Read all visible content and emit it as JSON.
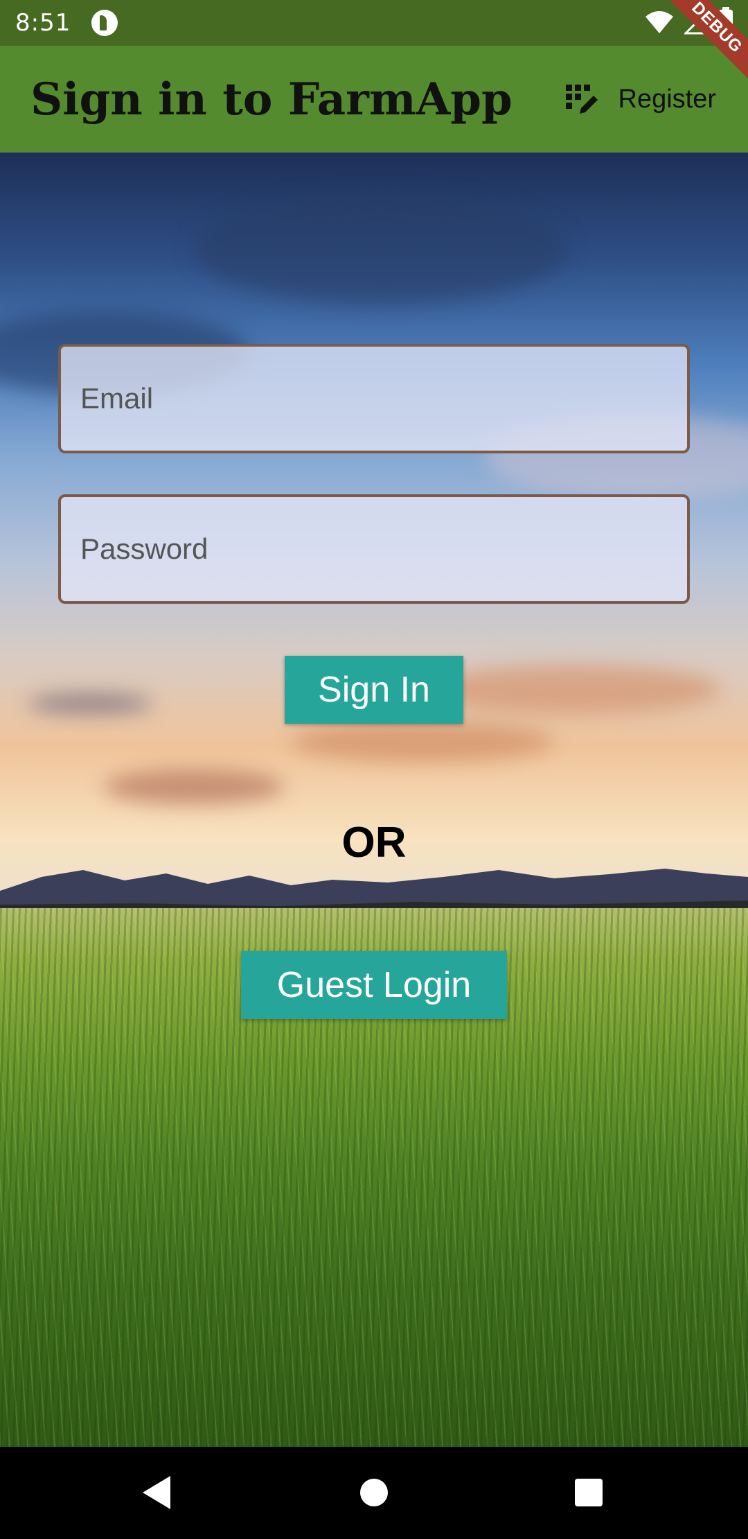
{
  "status_bar": {
    "time": "8:51",
    "icons": [
      "app-notification-icon",
      "wifi-icon",
      "signal-icon",
      "battery-icon"
    ]
  },
  "debug_banner": "DEBUG",
  "app_bar": {
    "title": "Sign in to FarmApp",
    "register_label": "Register",
    "register_icon": "app-registration-icon",
    "color": "#558b2f"
  },
  "form": {
    "email_placeholder": "Email",
    "email_value": "",
    "password_placeholder": "Password",
    "password_value": ""
  },
  "actions": {
    "sign_in_label": "Sign In",
    "or_label": "OR",
    "guest_login_label": "Guest Login",
    "button_color": "#26a69a"
  },
  "nav_bar": {
    "icons": [
      "back-icon",
      "home-icon",
      "recents-icon"
    ]
  }
}
